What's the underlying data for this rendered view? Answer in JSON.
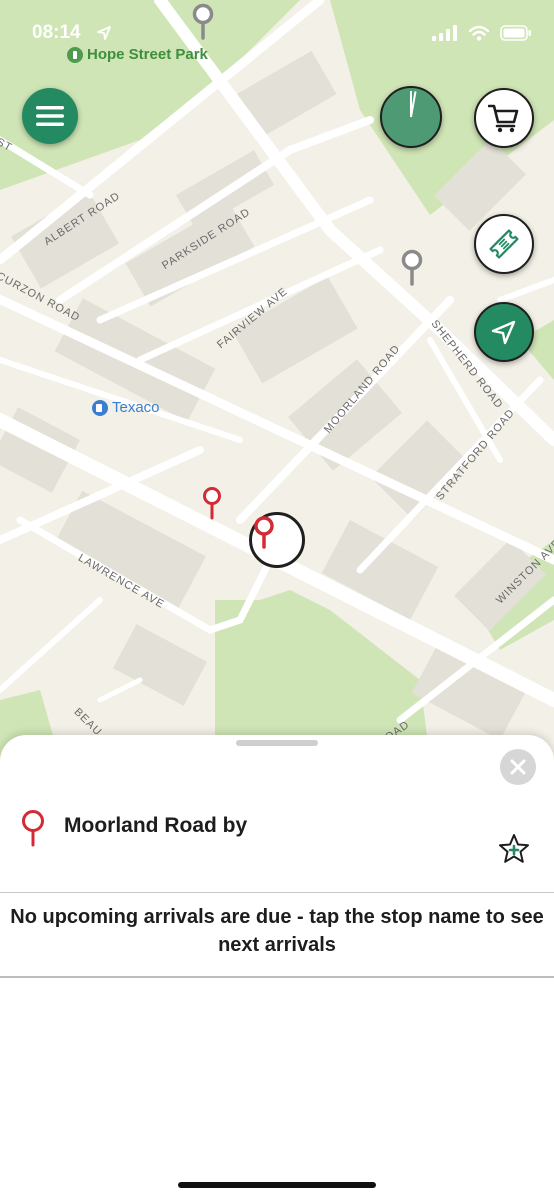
{
  "status_bar": {
    "time": "08:14"
  },
  "map": {
    "poi_park": "Hope Street Park",
    "poi_fuel": "Texaco",
    "roads": {
      "albert": "ALBERT ROAD",
      "parkside": "PARKSIDE ROAD",
      "curzon": "CURZON ROAD",
      "fairview": "FAIRVIEW AVE",
      "moorland": "MOORLAND ROAD",
      "shepherd": "SHEPHERD ROAD",
      "stratford": "STRATFORD ROAD",
      "winston": "WINSTON AVE",
      "lawrence": "LAWRENCE AVE",
      "beau": "BEAU",
      "st": "ST",
      "oad": "OAD"
    },
    "progress_fraction": 0.03
  },
  "sheet": {
    "stop_name": "Moorland Road by",
    "message": "No upcoming arrivals are due - tap the stop name to see next arrivals"
  },
  "colors": {
    "brand_green": "#2a8a66",
    "pin_red": "#d32b36",
    "park_green": "#cde4b2"
  }
}
